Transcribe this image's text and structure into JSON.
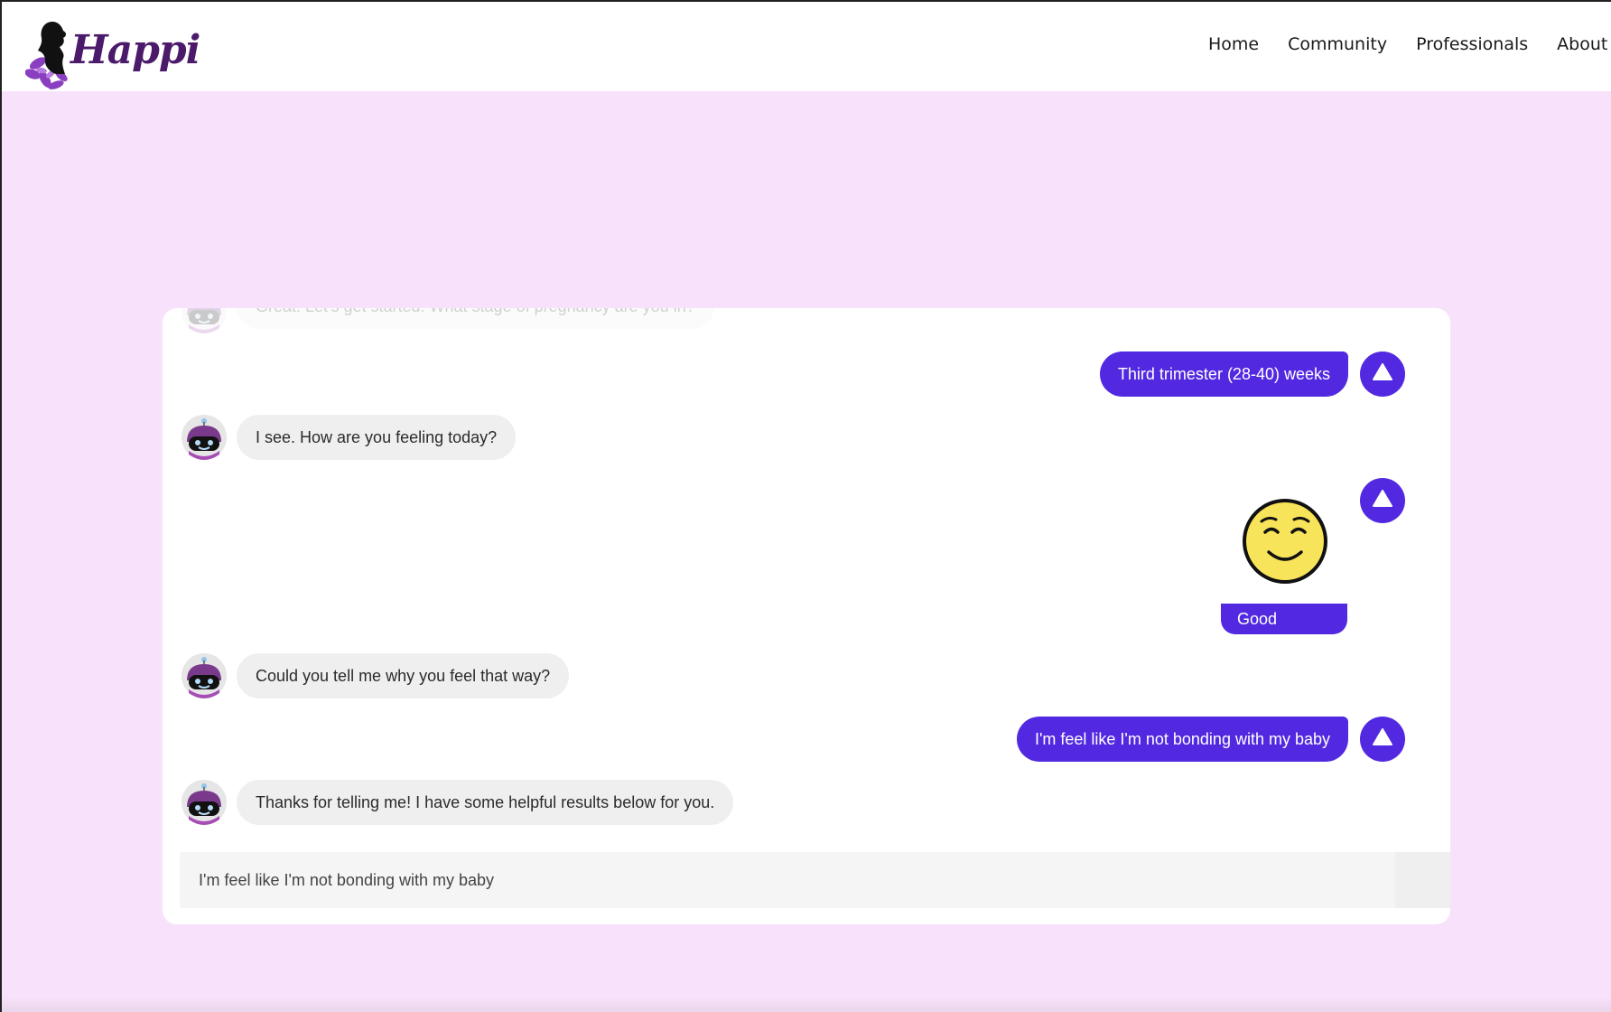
{
  "brand": {
    "name": "Happi",
    "logo_icon": "woman-silhouette-flower-logo",
    "color": "#4b1a6b"
  },
  "nav": {
    "items": [
      "Home",
      "Community",
      "Professionals",
      "About"
    ]
  },
  "colors": {
    "page_bg": "#f8e1fa",
    "accent": "#5229e0",
    "bot_bubble": "#efefef"
  },
  "chat": {
    "messages": [
      {
        "sender": "bot",
        "text": "Great! Let's get started. What stage of pregnancy are you in?"
      },
      {
        "sender": "user",
        "text": "Third trimester (28-40) weeks"
      },
      {
        "sender": "bot",
        "text": "I see. How are you feeling today?"
      },
      {
        "sender": "user",
        "type": "mood",
        "emoji": "relieved-face-icon",
        "label": "Good"
      },
      {
        "sender": "bot",
        "text": "Could you tell me why you feel that way?"
      },
      {
        "sender": "user",
        "text": "I'm feel like I'm not bonding with my baby"
      },
      {
        "sender": "bot",
        "text": "Thanks for telling me! I have some helpful results below for you."
      }
    ],
    "bot_avatar_icon": "robot-avatar-icon",
    "user_avatar_icon": "user-triangle-avatar-icon"
  },
  "input": {
    "value": "I'm feel like I'm not bonding with my baby"
  }
}
